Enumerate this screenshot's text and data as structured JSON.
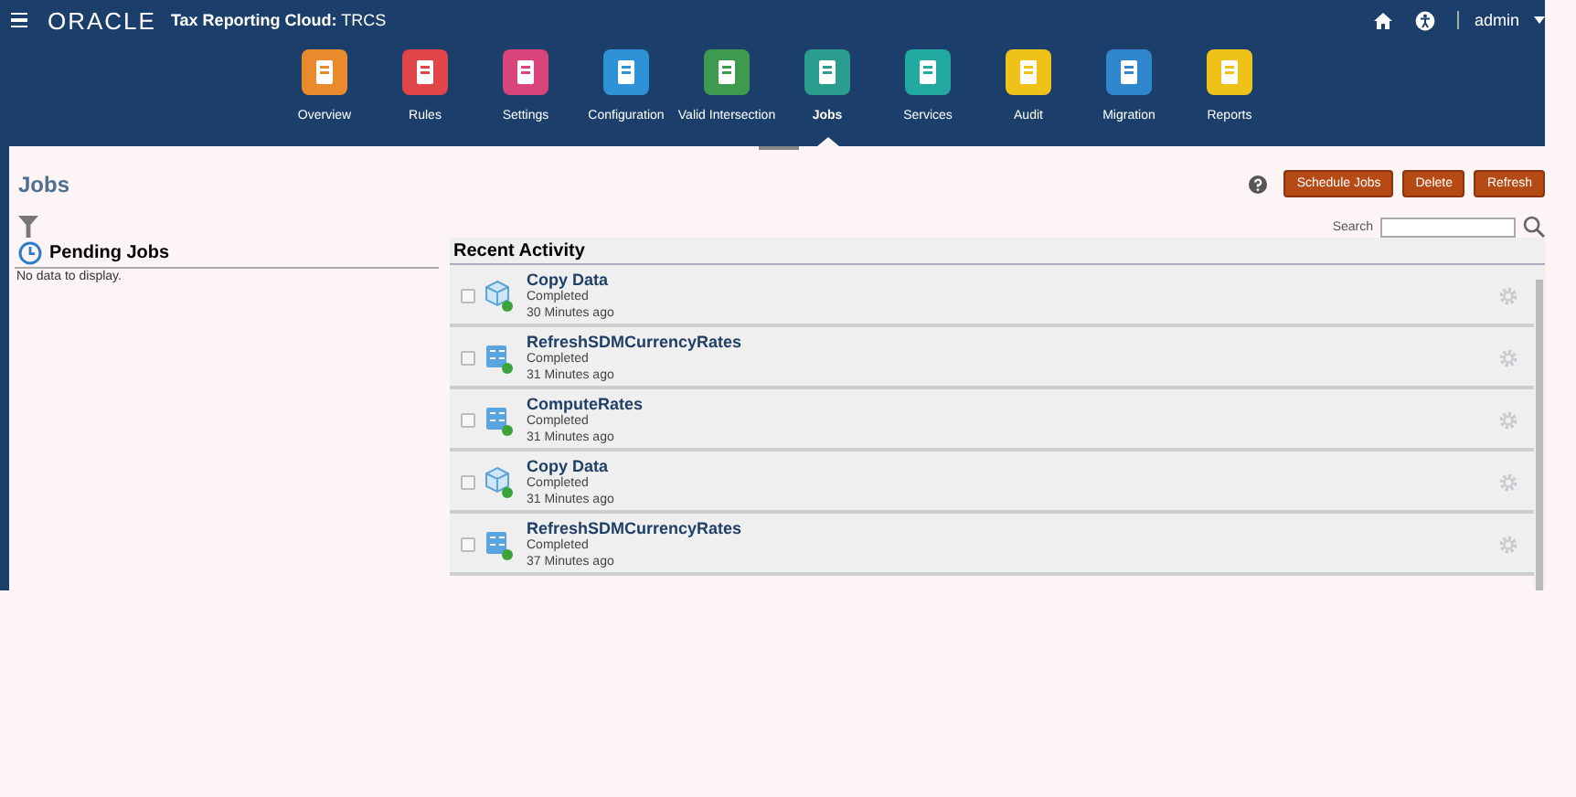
{
  "header": {
    "logo": "ORACLE",
    "app_title": "**Tax Reporting Cloud:** TRCS",
    "user": "admin"
  },
  "nav": [
    {
      "label": "Overview",
      "color": "#e98a2c",
      "selected": false
    },
    {
      "label": "Rules",
      "color": "#e0454a",
      "selected": false
    },
    {
      "label": "Settings",
      "color": "#d9457a",
      "selected": false
    },
    {
      "label": "Configuration",
      "color": "#2e93d6",
      "selected": false
    },
    {
      "label": "Valid Intersection",
      "color": "#3e9a4e",
      "selected": false
    },
    {
      "label": "Jobs",
      "color": "#2a9d8f",
      "selected": true
    },
    {
      "label": "Services",
      "color": "#22a9a0",
      "selected": false
    },
    {
      "label": "Audit",
      "color": "#efc21a",
      "selected": false
    },
    {
      "label": "Migration",
      "color": "#2e86cc",
      "selected": false
    },
    {
      "label": "Reports",
      "color": "#efc21a",
      "selected": false
    }
  ],
  "page_title": "Jobs",
  "buttons": [
    "Schedule Jobs",
    "Delete",
    "Refresh"
  ],
  "search": {
    "label": "Search"
  },
  "pending": {
    "title": "Pending Jobs",
    "empty": "No data to display."
  },
  "recent": {
    "title": "Recent Activity",
    "rows": [
      {
        "name": "Copy Data",
        "status": "Completed",
        "time": "30 Minutes ago",
        "kind": "data",
        "checked": false
      },
      {
        "name": "RefreshSDMCurrencyRates",
        "status": "Completed",
        "time": "31 Minutes ago",
        "kind": "rule",
        "checked": false
      },
      {
        "name": "ComputeRates",
        "status": "Completed",
        "time": "31 Minutes ago",
        "kind": "rule",
        "checked": false
      },
      {
        "name": "Copy Data",
        "status": "Completed",
        "time": "31 Minutes ago",
        "kind": "data",
        "checked": false
      },
      {
        "name": "RefreshSDMCurrencyRates",
        "status": "Completed",
        "time": "37 Minutes ago",
        "kind": "rule",
        "checked": false
      }
    ]
  }
}
